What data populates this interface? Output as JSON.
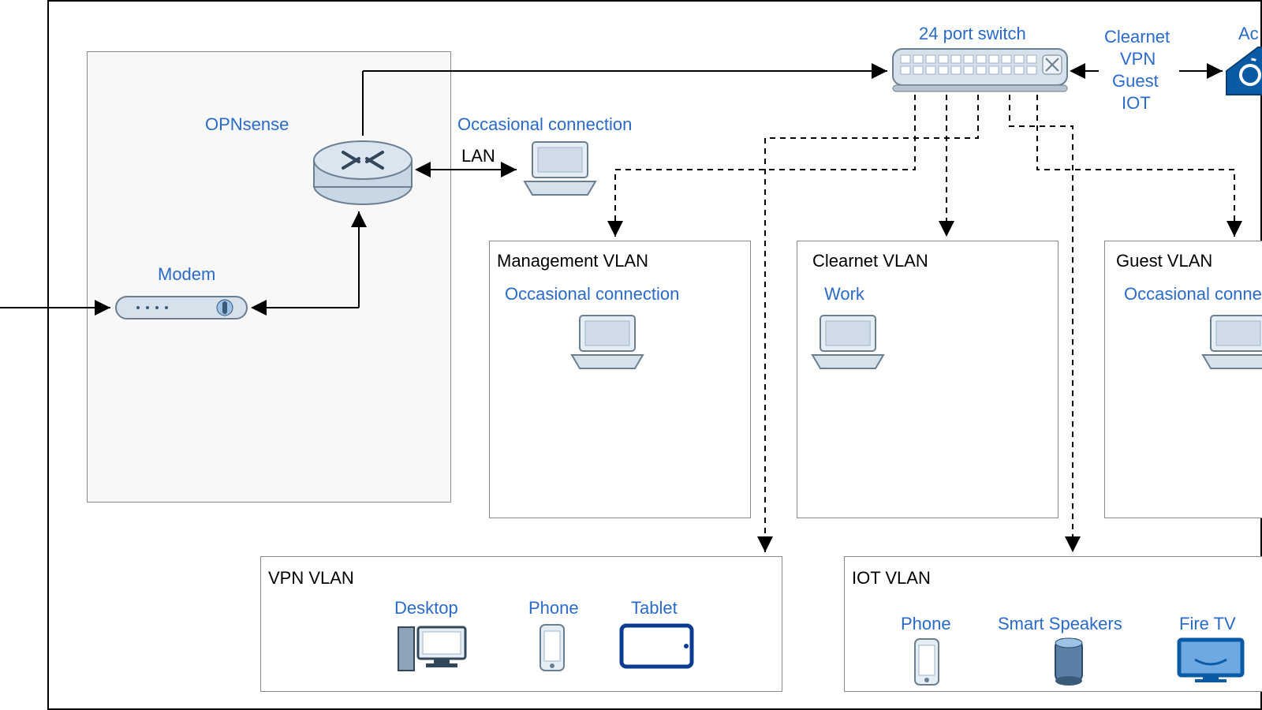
{
  "nodes": {
    "opnsense": "OPNsense",
    "modem": "Modem",
    "switch": "24 port switch",
    "occ_conn": "Occasional connection",
    "occ_conn2": "Occasional connection",
    "occ_conn3": "Occasional connection",
    "lan": "LAN",
    "work": "Work",
    "ap_partial": "Ac"
  },
  "trunk": {
    "l1": "Clearnet",
    "l2": "VPN",
    "l3": "Guest",
    "l4": "IOT"
  },
  "vlans": {
    "mgmt": "Management VLAN",
    "clearnet": "Clearnet VLAN",
    "guest": "Guest VLAN",
    "vpn": "VPN VLAN",
    "iot": "IOT VLAN"
  },
  "devices": {
    "desktop": "Desktop",
    "phone": "Phone",
    "tablet": "Tablet",
    "phone2": "Phone",
    "smartspk": "Smart Speakers",
    "firetv": "Fire TV"
  }
}
